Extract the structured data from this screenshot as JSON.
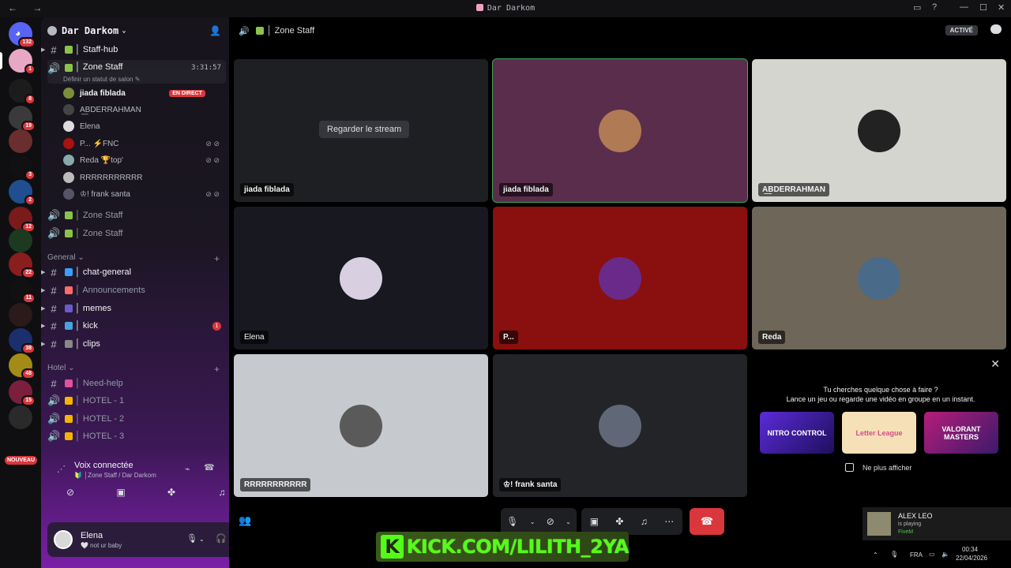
{
  "window": {
    "title": "Dar Darkom",
    "nav": "← →"
  },
  "rail": {
    "home_badge": "132",
    "servers": [
      {
        "name": "pink-avatar",
        "badge": "1",
        "color": "#e9a7c6"
      },
      {
        "name": "T",
        "badge": "8",
        "color": "#1c1c1c"
      },
      {
        "name": "server-3",
        "badge": "19",
        "color": "#3a3a3a"
      },
      {
        "name": "server-4",
        "badge": "",
        "color": "#6b2e2e"
      },
      {
        "name": "EV",
        "badge": "3",
        "color": "#111"
      },
      {
        "name": "server-6",
        "badge": "2",
        "color": "#1f4f8f"
      },
      {
        "name": "server-7",
        "badge": "12",
        "color": "#7a1a1a"
      },
      {
        "name": "server-8",
        "badge": "",
        "color": "#1c3a20"
      },
      {
        "name": "server-9",
        "badge": "22",
        "color": "#8a1d1d"
      },
      {
        "name": "TNK",
        "badge": "11",
        "color": "#111"
      },
      {
        "name": "server-11",
        "badge": "",
        "color": "#2a1a1a"
      },
      {
        "name": "server-12",
        "badge": "38",
        "color": "#1a2f6b"
      },
      {
        "name": "server-13",
        "badge": "48",
        "color": "#a48a17"
      },
      {
        "name": "server-14",
        "badge": "15",
        "color": "#7b1f3d"
      },
      {
        "name": "server-15",
        "badge": "",
        "color": "#2a2a2a"
      }
    ],
    "nouveau": "NOUVEAU"
  },
  "sidebar": {
    "server_name": "Dar Darkom",
    "channels_top": [
      {
        "type": "text",
        "name": "│ Staff-hub"
      },
      {
        "type": "voice",
        "name": "│ Zone Staff",
        "time": "3:31:57",
        "status": "Définir un statut de salon ✎"
      }
    ],
    "voice_users": [
      {
        "name": "jiada fiblada",
        "live": "EN DIRECT",
        "color": "#7a8f3a"
      },
      {
        "name": "A͟BDERRAHMAN",
        "color": "#444"
      },
      {
        "name": "Elena",
        "color": "#ddd"
      },
      {
        "name": "P... ⚡FNC",
        "color": "#a11"
      },
      {
        "name": "Reda 🏆top'",
        "color": "#8aa"
      },
      {
        "name": "RRRRRRRRRRR",
        "color": "#bbb"
      },
      {
        "name": "♔! frank santa",
        "color": "#556"
      }
    ],
    "channels_mid": [
      {
        "type": "voice",
        "name": "│ Zone Staff"
      },
      {
        "type": "voice",
        "name": "│ Zone Staff"
      }
    ],
    "categories": [
      {
        "name": "General",
        "channels": [
          {
            "name": "│ chat-general",
            "bold": true
          },
          {
            "name": "│ Announcements",
            "bold": false
          },
          {
            "name": "│ memes",
            "bold": true
          },
          {
            "name": "│ kick",
            "bold": true,
            "unread": "1"
          },
          {
            "name": "│ clips",
            "bold": true
          }
        ]
      },
      {
        "name": "Hotel",
        "channels": [
          {
            "name": "│ Need-help",
            "type": "text"
          },
          {
            "name": "│ HOTEL - 1",
            "type": "voice"
          },
          {
            "name": "│ HOTEL - 2",
            "type": "voice"
          },
          {
            "name": "│ HOTEL - 3",
            "type": "voice"
          }
        ]
      }
    ],
    "voice_connected": {
      "title": "Voix connectée",
      "subtitle": "🔰 │Zone Staff / Dar Darkom"
    },
    "me": {
      "name": "Elena",
      "status": "🤍 not ur baby"
    }
  },
  "main": {
    "channel": "│ Zone Staff",
    "active_label": "ACTIVÉ",
    "watch_stream": "Regarder le stream",
    "tiles": [
      {
        "label": "jiada fiblada",
        "bg": "#1e1f22",
        "avatar": "",
        "type": "stream"
      },
      {
        "label": "jiada fiblada",
        "bg": "#5a2d4d",
        "avatar": "#b07a55"
      },
      {
        "label": "A͟BDERRAHMAN",
        "bg": "#d5d5d0",
        "avatar": "#222"
      },
      {
        "label": "Elena",
        "bg": "#181820",
        "avatar": "#d8d0e0"
      },
      {
        "label": "P...",
        "bg": "#8a0f0f",
        "avatar": "#6a2a8a"
      },
      {
        "label": "Reda",
        "bg": "#6e6658",
        "avatar": "#4a6a8a"
      },
      {
        "label": "RRRRRRRRRRR",
        "bg": "#c6c9ce",
        "avatar": "#5a5a5a"
      },
      {
        "label": "♔! frank santa",
        "bg": "#232428",
        "avatar": "#606878"
      }
    ],
    "promo": {
      "title": "Tu cherches quelque chose à faire ?",
      "subtitle": "Lance un jeu ou regarde une vidéo en groupe en un instant.",
      "cards": [
        "NITRO CONTROL",
        "Letter League",
        "VALORANT MASTERS"
      ],
      "checkbox": "Ne plus afficher"
    }
  },
  "overlay": {
    "kick": "KICK.COM/LILITH_2YA"
  },
  "notification": {
    "name": "ALEX LEO",
    "line": "is playing",
    "game": "FiveM"
  },
  "tray": {
    "lang": "FRA",
    "time": "00:34",
    "date": "22/04/2026"
  }
}
